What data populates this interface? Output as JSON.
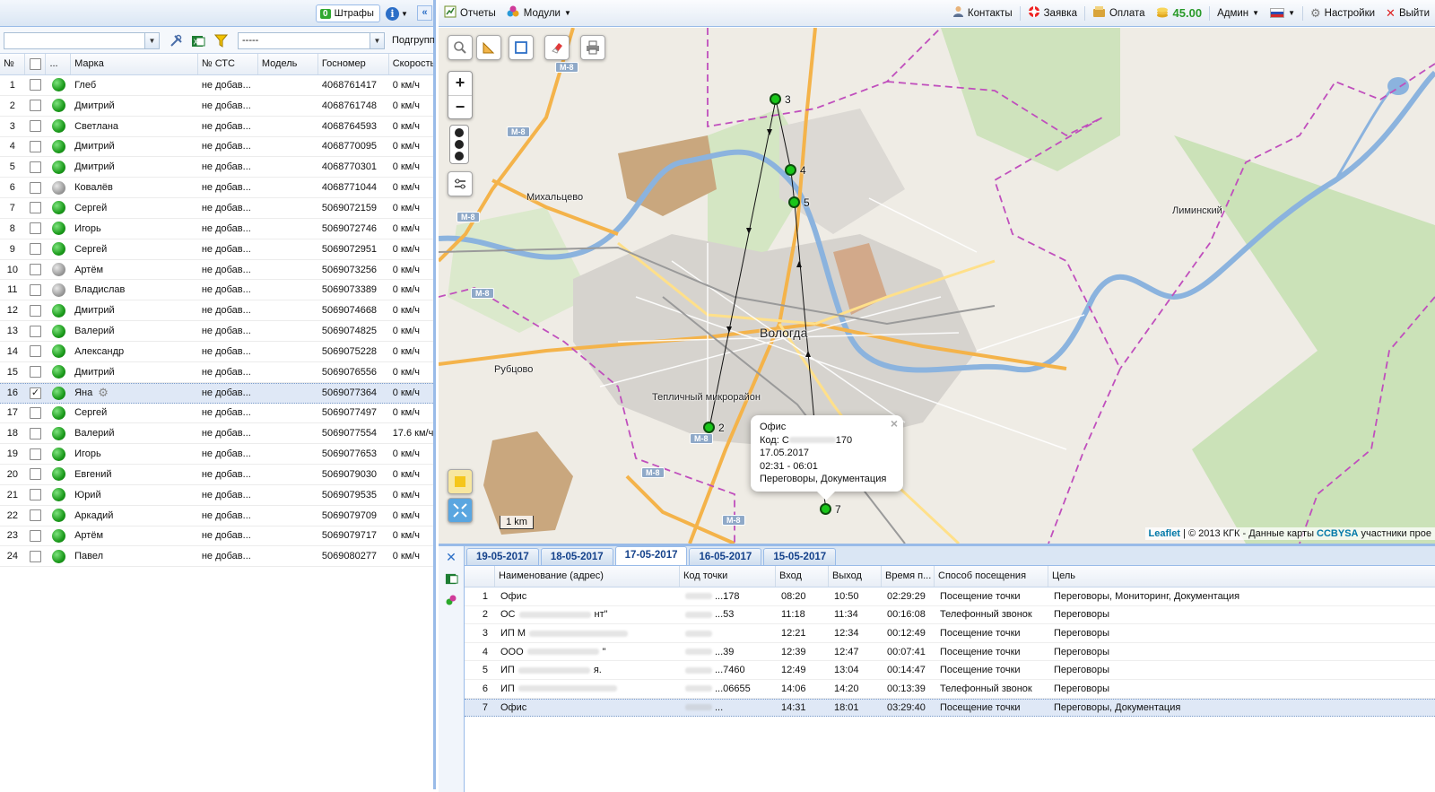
{
  "left_toolbar": {
    "fines_count": "0",
    "fines_label": "Штрафы",
    "info_icon": "info-icon",
    "collapse_label": "«"
  },
  "filter": {
    "group_value": "",
    "mode_value": "-----",
    "subgroup_label": "Подгрупп"
  },
  "vehicle_grid": {
    "columns": [
      "№",
      "",
      "...",
      "Марка",
      "№ СТС",
      "Модель",
      "Госномер",
      "Скорость"
    ],
    "rows": [
      {
        "n": "1",
        "name": "Глеб",
        "sts": "не добав...",
        "plate": "4068761417",
        "speed": "0 км/ч",
        "status": "green",
        "checked": ""
      },
      {
        "n": "2",
        "name": "Дмитрий",
        "sts": "не добав...",
        "plate": "4068761748",
        "speed": "0 км/ч",
        "status": "green",
        "checked": ""
      },
      {
        "n": "3",
        "name": "Светлана",
        "sts": "не добав...",
        "plate": "4068764593",
        "speed": "0 км/ч",
        "status": "green",
        "checked": ""
      },
      {
        "n": "4",
        "name": "Дмитрий",
        "sts": "не добав...",
        "plate": "4068770095",
        "speed": "0 км/ч",
        "status": "green",
        "checked": ""
      },
      {
        "n": "5",
        "name": "Дмитрий",
        "sts": "не добав...",
        "plate": "4068770301",
        "speed": "0 км/ч",
        "status": "green",
        "checked": ""
      },
      {
        "n": "6",
        "name": "Ковалёв",
        "sts": "не добав...",
        "plate": "4068771044",
        "speed": "0 км/ч",
        "status": "grey",
        "checked": ""
      },
      {
        "n": "7",
        "name": "Сергей",
        "sts": "не добав...",
        "plate": "5069072159",
        "speed": "0 км/ч",
        "status": "green",
        "checked": ""
      },
      {
        "n": "8",
        "name": "Игорь",
        "sts": "не добав...",
        "plate": "5069072746",
        "speed": "0 км/ч",
        "status": "green",
        "checked": ""
      },
      {
        "n": "9",
        "name": "Сергей",
        "sts": "не добав...",
        "plate": "5069072951",
        "speed": "0 км/ч",
        "status": "green",
        "checked": ""
      },
      {
        "n": "10",
        "name": "Артём",
        "sts": "не добав...",
        "plate": "5069073256",
        "speed": "0 км/ч",
        "status": "grey",
        "checked": ""
      },
      {
        "n": "11",
        "name": "Владислав",
        "sts": "не добав...",
        "plate": "5069073389",
        "speed": "0 км/ч",
        "status": "grey",
        "checked": ""
      },
      {
        "n": "12",
        "name": "Дмитрий",
        "sts": "не добав...",
        "plate": "5069074668",
        "speed": "0 км/ч",
        "status": "green",
        "checked": ""
      },
      {
        "n": "13",
        "name": "Валерий",
        "sts": "не добав...",
        "plate": "5069074825",
        "speed": "0 км/ч",
        "status": "green",
        "checked": ""
      },
      {
        "n": "14",
        "name": "Александр",
        "sts": "не добав...",
        "plate": "5069075228",
        "speed": "0 км/ч",
        "status": "green",
        "checked": ""
      },
      {
        "n": "15",
        "name": "Дмитрий",
        "sts": "не добав...",
        "plate": "5069076556",
        "speed": "0 км/ч",
        "status": "green",
        "checked": ""
      },
      {
        "n": "16",
        "name": "Яна",
        "sts": "не добав...",
        "plate": "5069077364",
        "speed": "0 км/ч",
        "status": "green",
        "checked": "✓",
        "selected": true
      },
      {
        "n": "17",
        "name": "Сергей",
        "sts": "не добав...",
        "plate": "5069077497",
        "speed": "0 км/ч",
        "status": "green",
        "checked": ""
      },
      {
        "n": "18",
        "name": "Валерий",
        "sts": "не добав...",
        "plate": "5069077554",
        "speed": "17.6 км/ч",
        "status": "green",
        "checked": ""
      },
      {
        "n": "19",
        "name": "Игорь",
        "sts": "не добав...",
        "plate": "5069077653",
        "speed": "0 км/ч",
        "status": "green",
        "checked": ""
      },
      {
        "n": "20",
        "name": "Евгений",
        "sts": "не добав...",
        "plate": "5069079030",
        "speed": "0 км/ч",
        "status": "green",
        "checked": ""
      },
      {
        "n": "21",
        "name": "Юрий",
        "sts": "не добав...",
        "plate": "5069079535",
        "speed": "0 км/ч",
        "status": "green",
        "checked": ""
      },
      {
        "n": "22",
        "name": "Аркадий",
        "sts": "не добав...",
        "plate": "5069079709",
        "speed": "0 км/ч",
        "status": "green",
        "checked": ""
      },
      {
        "n": "23",
        "name": "Артём",
        "sts": "не добав...",
        "plate": "5069079717",
        "speed": "0 км/ч",
        "status": "green",
        "checked": ""
      },
      {
        "n": "24",
        "name": "Павел",
        "sts": "не добав...",
        "plate": "5069080277",
        "speed": "0 км/ч",
        "status": "green",
        "checked": ""
      }
    ]
  },
  "topbar": {
    "reports": "Отчеты",
    "modules": "Модули",
    "contacts": "Контакты",
    "request": "Заявка",
    "payment": "Оплата",
    "balance": "45.00",
    "admin": "Админ",
    "settings": "Настройки",
    "exit": "Выйти"
  },
  "map": {
    "city": "Вологда",
    "labels": [
      "Михальцево",
      "Рубцово",
      "Тепличный микрорайон",
      "Лиминский"
    ],
    "roads": [
      "M-8",
      "M-8",
      "M-8",
      "M-8",
      "M-8",
      "M-8",
      "M-8"
    ],
    "markers": [
      "2",
      "3",
      "4",
      "5",
      "7"
    ],
    "scale": "1 km",
    "attribution_prefix": "Leaflet",
    "attribution_text": " | © 2013 КГК - Данные карты ",
    "attribution_link": "CCBYSA",
    "attribution_suffix": " участники прое",
    "popup": {
      "title": "Офис",
      "code": "Код: С",
      "code_tail": "170",
      "date": "17.05.2017",
      "time": "02:31 - 06:01",
      "goal": "Переговоры, Документация"
    }
  },
  "visits": {
    "tabs": [
      "19-05-2017",
      "18-05-2017",
      "17-05-2017",
      "16-05-2017",
      "15-05-2017"
    ],
    "active_tab": "17-05-2017",
    "columns": [
      "Наименование (адрес)",
      "Код точки",
      "Вход",
      "Выход",
      "Время п...",
      "Способ посещения",
      "Цель"
    ],
    "rows": [
      {
        "n": "1",
        "name": "Офис",
        "code": "...178",
        "in": "08:20",
        "out": "10:50",
        "time": "02:29:29",
        "way": "Посещение точки",
        "goal": "Переговоры, Мониторинг, Документация"
      },
      {
        "n": "2",
        "name": "ОС",
        "name_tail": "нт\"",
        "code": "...53",
        "in": "11:18",
        "out": "11:34",
        "time": "00:16:08",
        "way": "Телефонный звонок",
        "goal": "Переговоры"
      },
      {
        "n": "3",
        "name": "ИП М",
        "name_tail": "",
        "code": "",
        "in": "12:21",
        "out": "12:34",
        "time": "00:12:49",
        "way": "Посещение точки",
        "goal": "Переговоры"
      },
      {
        "n": "4",
        "name": "ООО",
        "name_tail": "\"",
        "code": "...39",
        "in": "12:39",
        "out": "12:47",
        "time": "00:07:41",
        "way": "Посещение точки",
        "goal": "Переговоры"
      },
      {
        "n": "5",
        "name": "ИП",
        "name_tail": "я.",
        "code": "...7460",
        "in": "12:49",
        "out": "13:04",
        "time": "00:14:47",
        "way": "Посещение точки",
        "goal": "Переговоры"
      },
      {
        "n": "6",
        "name": "ИП",
        "name_tail": "",
        "code": "...06655",
        "in": "14:06",
        "out": "14:20",
        "time": "00:13:39",
        "way": "Телефонный звонок",
        "goal": "Переговоры"
      },
      {
        "n": "7",
        "name": "Офис",
        "code": "...",
        "in": "14:31",
        "out": "18:01",
        "time": "03:29:40",
        "way": "Посещение точки",
        "goal": "Переговоры, Документация",
        "selected": true
      }
    ]
  },
  "colors": {
    "panel_border": "#99bbe8",
    "status_green": "#1c9b1c",
    "status_grey": "#9c9c9c",
    "balance_green": "#2a9a2a",
    "tab_text": "#15428b"
  }
}
